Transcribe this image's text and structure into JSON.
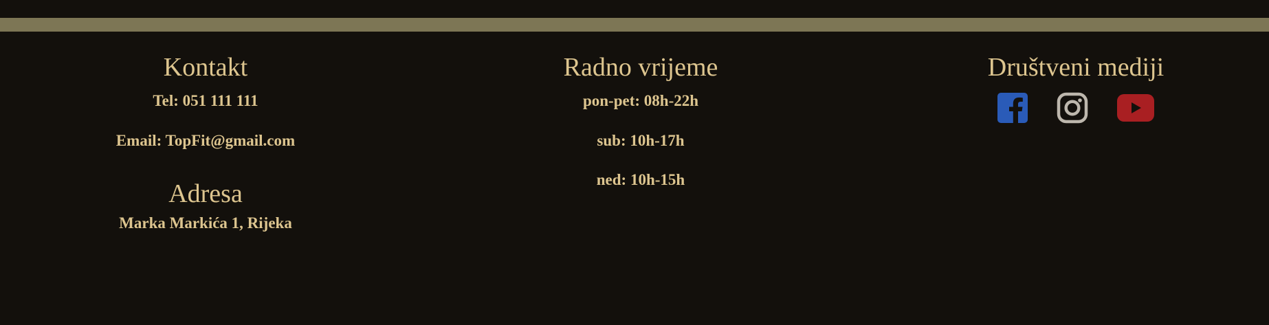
{
  "footer": {
    "kontakt": {
      "heading": "Kontakt",
      "tel": "Tel: 051 111 111",
      "email": "Email: TopFit@gmail.com"
    },
    "adresa": {
      "heading": "Adresa",
      "address": "Marka Markića 1, Rijeka"
    },
    "radno_vrijeme": {
      "heading": "Radno vrijeme",
      "lines": [
        "pon-pet: 08h-22h",
        "sub: 10h-17h",
        "ned: 10h-15h"
      ]
    },
    "drustveni_mediji": {
      "heading": "Društveni mediji",
      "icons": [
        {
          "name": "facebook-icon",
          "color": "#2a5bb8"
        },
        {
          "name": "instagram-icon",
          "color": "#bdb7ad"
        },
        {
          "name": "youtube-icon",
          "color": "#a91f22"
        }
      ]
    },
    "colors": {
      "background": "#13100c",
      "accent_bar": "#7d7655",
      "text": "#ddc58f"
    }
  }
}
